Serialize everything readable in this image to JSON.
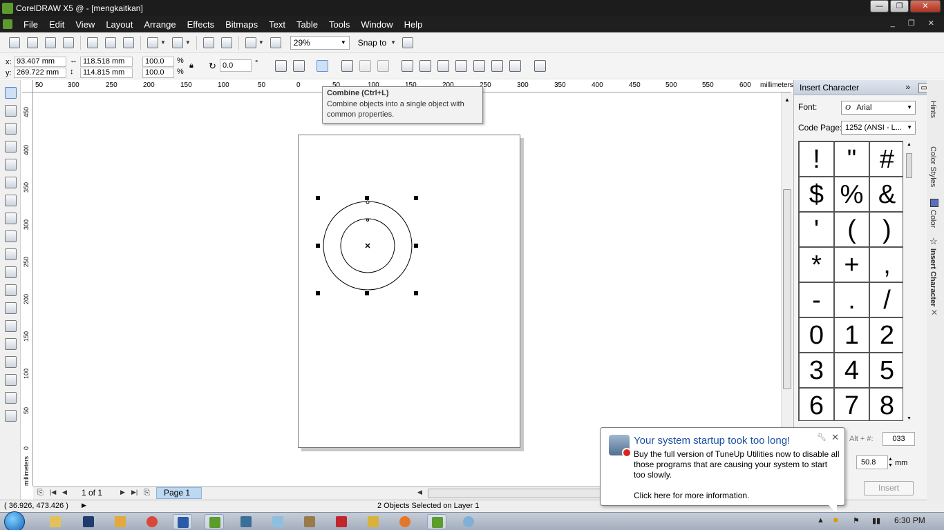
{
  "window": {
    "title": "CorelDRAW X5 @ - [mengkaitkan]",
    "controls": {
      "minimize": "—",
      "maximize": "❐",
      "close": "✕"
    }
  },
  "menubar": {
    "items": [
      "File",
      "Edit",
      "View",
      "Layout",
      "Arrange",
      "Effects",
      "Bitmaps",
      "Text",
      "Table",
      "Tools",
      "Window",
      "Help"
    ],
    "doc_controls": "_ ❐ ✕"
  },
  "toolbar": {
    "zoom": "29%",
    "snap_to": "Snap to"
  },
  "propbar": {
    "x_label": "x:",
    "x": "93.407 mm",
    "y_label": "y:",
    "y": "269.722 mm",
    "width": "118.518 mm",
    "height": "114.815 mm",
    "scale_x": "100.0",
    "scale_y": "100.0",
    "percent": "%",
    "rotation": "0.0",
    "degree": "°"
  },
  "tooltip": {
    "title": "Combine (Ctrl+L)",
    "body": "Combine  objects into a single object with common properties."
  },
  "ruler": {
    "top_labels": [
      "50",
      "300",
      "250",
      "200",
      "150",
      "100",
      "50",
      "0",
      "50",
      "100",
      "150",
      "200",
      "250",
      "300",
      "350",
      "400",
      "450",
      "500",
      "550",
      "600"
    ],
    "unit": "millimeters",
    "left_labels": [
      "450",
      "400",
      "350",
      "300",
      "250",
      "200",
      "150",
      "100",
      "50",
      "0"
    ],
    "left_unit": "millimeters"
  },
  "pagebar": {
    "page_count": "1 of 1",
    "page_tab": "Page 1"
  },
  "statusbar": {
    "coords": "( 36.926, 473.426 )",
    "selection": "2 Objects Selected on Layer 1"
  },
  "docker": {
    "title": "Insert Character",
    "font_label": "Font:",
    "font_value": "Arial",
    "codepage_label": "Code Page:",
    "codepage_value": "1252  (ANSI - L...",
    "characters": [
      "!",
      "\"",
      "#",
      "$",
      "%",
      "&",
      "'",
      "(",
      ")",
      "*",
      "+",
      ",",
      "-",
      ".",
      "/",
      "0",
      "1",
      "2",
      "3",
      "4",
      "5",
      "6",
      "7",
      "8"
    ],
    "alt_label": "Alt + #:",
    "char_code": "033",
    "size_value": "50.8",
    "size_unit": "mm",
    "insert_button": "Insert"
  },
  "sidetabs": [
    "Hints",
    "Color Styles",
    "Color",
    "Insert Character"
  ],
  "notification": {
    "title": "Your system startup took too long!",
    "body": "Buy the full version of TuneUp Utilities now to disable all those programs that are causing your system to start too slowly.",
    "link": "Click here for more information."
  },
  "taskbar": {
    "clock": "6:30 PM"
  }
}
